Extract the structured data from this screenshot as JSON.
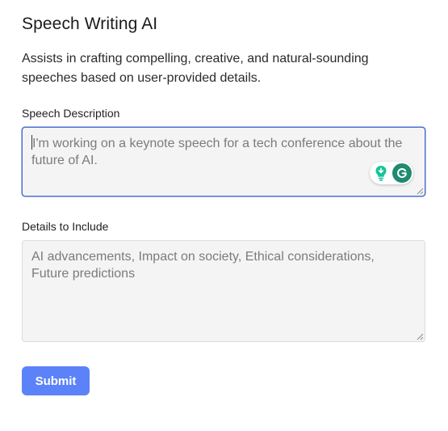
{
  "header": {
    "title": "Speech Writing AI",
    "description": "Assists in crafting compelling, creative, and natural-sounding speeches based on user-provided details."
  },
  "form": {
    "speech_description": {
      "label": "Speech Description",
      "placeholder": "I'm working on a keynote speech for a tech conference about the future of AI."
    },
    "details": {
      "label": "Details to Include",
      "placeholder": "AI advancements, Impact on society, Ethical considerations, Future predictions"
    },
    "submit_label": "Submit"
  },
  "colors": {
    "accent": "#5b82f8",
    "focus_border": "#4a6fd1",
    "grammarly_green": "#1f8a70",
    "field_bg": "#f4f4f4"
  },
  "icons": {
    "extension_widget": [
      "lightbulb-icon",
      "grammarly-icon"
    ],
    "resize": "resize-handle-icon"
  }
}
